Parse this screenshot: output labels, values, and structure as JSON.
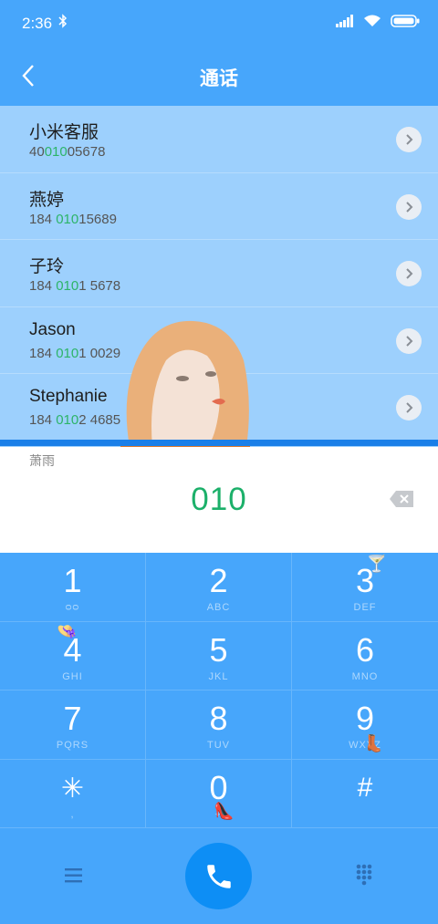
{
  "status": {
    "time": "2:36"
  },
  "header": {
    "title": "通话"
  },
  "contacts": [
    {
      "name": "小米客服",
      "num_pre": "40",
      "num_hl": "010",
      "num_post": "05678"
    },
    {
      "name": "燕婷",
      "num_pre": "184 ",
      "num_hl": "010",
      "num_post": "15689"
    },
    {
      "name": "子玲",
      "num_pre": "184 ",
      "num_hl": "010",
      "num_post": "1 5678"
    },
    {
      "name": "Jason",
      "num_pre": "184 ",
      "num_hl": "010",
      "num_post": "1 0029"
    },
    {
      "name": "Stephanie",
      "num_pre": "184 ",
      "num_hl": "010",
      "num_post": "2 4685"
    }
  ],
  "peek_name": "萧雨",
  "dialer": {
    "entered": "010"
  },
  "keys": [
    {
      "digit": "1",
      "letters": "ᴑᴑ"
    },
    {
      "digit": "2",
      "letters": "ABC"
    },
    {
      "digit": "3",
      "letters": "DEF"
    },
    {
      "digit": "4",
      "letters": "GHI"
    },
    {
      "digit": "5",
      "letters": "JKL"
    },
    {
      "digit": "6",
      "letters": "MNO"
    },
    {
      "digit": "7",
      "letters": "PQRS"
    },
    {
      "digit": "8",
      "letters": "TUV"
    },
    {
      "digit": "9",
      "letters": "WXYZ"
    },
    {
      "digit": "✳",
      "letters": ","
    },
    {
      "digit": "0",
      "letters": "+"
    },
    {
      "digit": "#",
      "letters": ""
    }
  ],
  "icons": {
    "back": "chevron-left-icon",
    "chevron": "chevron-right-icon",
    "backspace": "backspace-icon",
    "menu": "menu-icon",
    "call": "phone-icon",
    "keypad": "dialpad-icon"
  },
  "colors": {
    "primary": "#47a6fb",
    "list_bg": "#9dd0fd",
    "highlight": "#2db468",
    "call": "#0d8ef5"
  }
}
